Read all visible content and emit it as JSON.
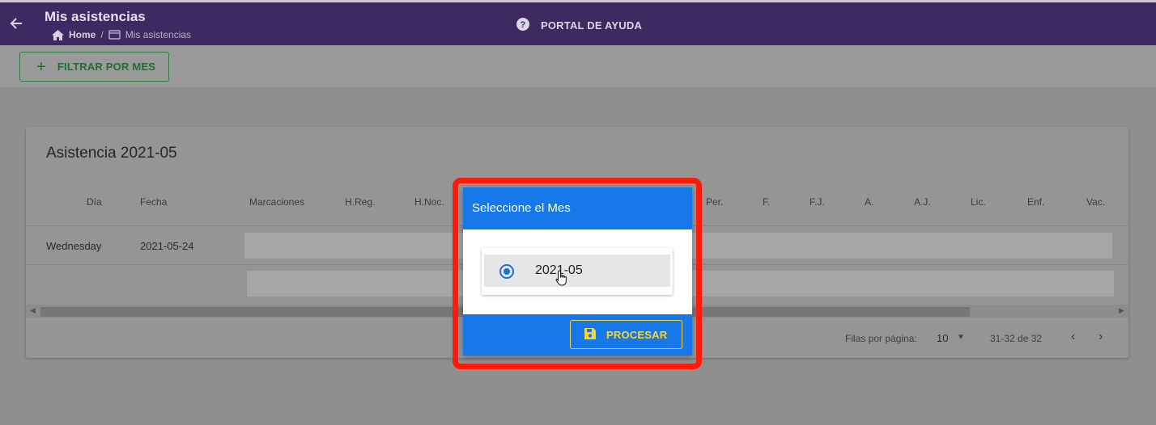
{
  "header": {
    "title": "Mis asistencias",
    "breadcrumb_home": "Home",
    "breadcrumb_sep": "/",
    "breadcrumb_current": "Mis asistencias",
    "help_label": "PORTAL DE AYUDA",
    "icons": [
      "back-arrow-icon",
      "home-icon",
      "card-icon",
      "help-icon"
    ]
  },
  "toolbar": {
    "filter_label": "FILTRAR POR MES",
    "filter_icon": "plus-icon"
  },
  "card": {
    "title": "Asistencia 2021-05",
    "columns": [
      "Día",
      "Fecha",
      "Marcaciones",
      "H.Reg.",
      "H.Noc.",
      "Per.",
      "F.",
      "F.J.",
      "A.",
      "A.J.",
      "Lic.",
      "Enf.",
      "Vac."
    ],
    "rows": [
      {
        "dia": "Wednesday",
        "fecha": "2021-05-24"
      },
      {
        "dia": "",
        "fecha": ""
      }
    ]
  },
  "pagination": {
    "rows_per_page_label": "Filas por página:",
    "rows_per_page_value": "10",
    "range": "31-32 de 32"
  },
  "modal": {
    "title": "Seleccione el Mes",
    "options": [
      {
        "label": "2021-05",
        "selected": true
      }
    ],
    "process_label": "PROCESAR",
    "process_icon": "save-icon"
  },
  "colors": {
    "header_purple": "#3e2a61",
    "modal_blue": "#1778ea",
    "highlight_red": "#ff1a0a",
    "process_yellow": "#f6d534",
    "filter_green": "#226b31"
  }
}
